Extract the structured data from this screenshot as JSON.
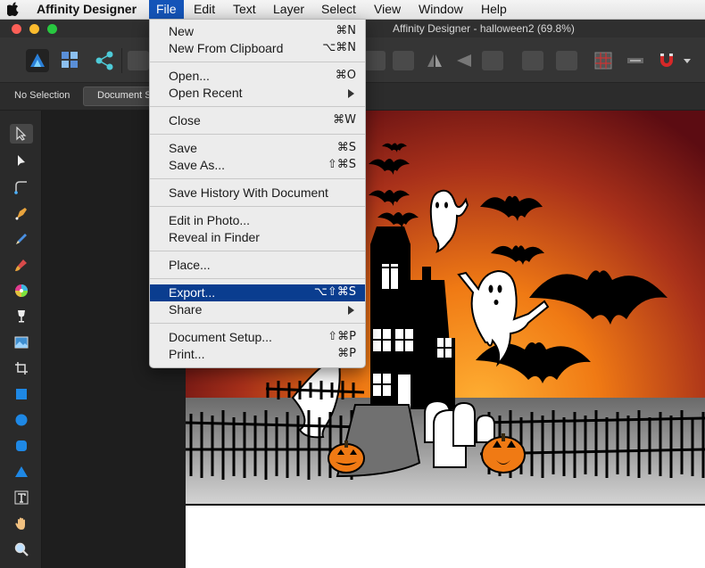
{
  "menubar": {
    "app_name": "Affinity Designer",
    "items": [
      "File",
      "Edit",
      "Text",
      "Layer",
      "Select",
      "View",
      "Window",
      "Help"
    ],
    "active": "File"
  },
  "window": {
    "title": "Affinity Designer - halloween2 (69.8%)"
  },
  "context_bar": {
    "selection_label": "No Selection",
    "document_setup_label": "Document Setup..."
  },
  "file_menu": {
    "groups": [
      [
        {
          "label": "New",
          "shortcut": "⌘N"
        },
        {
          "label": "New From Clipboard",
          "shortcut": "⌥⌘N"
        }
      ],
      [
        {
          "label": "Open...",
          "shortcut": "⌘O"
        },
        {
          "label": "Open Recent",
          "submenu": true
        }
      ],
      [
        {
          "label": "Close",
          "shortcut": "⌘W"
        }
      ],
      [
        {
          "label": "Save",
          "shortcut": "⌘S"
        },
        {
          "label": "Save As...",
          "shortcut": "⇧⌘S"
        }
      ],
      [
        {
          "label": "Save History With Document"
        }
      ],
      [
        {
          "label": "Edit in Photo..."
        },
        {
          "label": "Reveal in Finder"
        }
      ],
      [
        {
          "label": "Place..."
        }
      ],
      [
        {
          "label": "Export...",
          "shortcut": "⌥⇧⌘S",
          "highlighted": true
        },
        {
          "label": "Share",
          "submenu": true
        }
      ],
      [
        {
          "label": "Document Setup...",
          "shortcut": "⇧⌘P"
        },
        {
          "label": "Print...",
          "shortcut": "⌘P"
        }
      ]
    ]
  },
  "colors": {
    "menu_highlight": "#0a3d8f",
    "sky_top": "#5c0c12",
    "sky_glow": "#ff8a1a",
    "ground": "#9a9a9a"
  }
}
